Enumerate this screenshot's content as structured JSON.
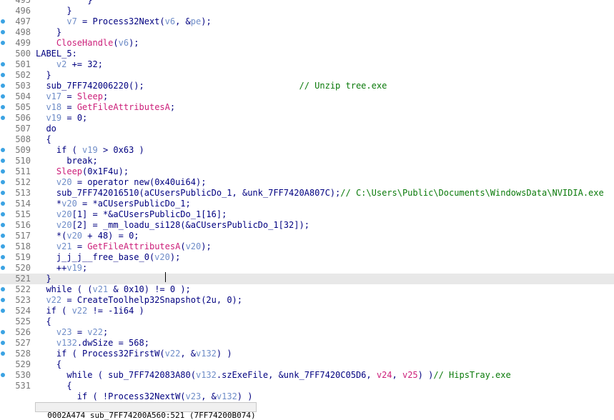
{
  "colors": {
    "background": "#ffffff",
    "line_number": "#777777",
    "keyword": "#000080",
    "variable": "#6f8dc8",
    "api_call": "#cc1f7a",
    "comment": "#0a7a0a",
    "breakpoint_dot": "#3ba3e3",
    "current_line_highlight": "#e8e8e8"
  },
  "status_bar": {
    "text": "0002A474 sub_7FF74200A560:521 (7FF74200B074)"
  },
  "code_lines": [
    {
      "ln": "495",
      "bp": false,
      "segs": [
        {
          "t": "          }",
          "k": "txt"
        }
      ]
    },
    {
      "ln": "496",
      "bp": false,
      "segs": [
        {
          "t": "      }",
          "k": "txt"
        }
      ]
    },
    {
      "ln": "497",
      "bp": true,
      "segs": [
        {
          "t": "      ",
          "k": "txt"
        },
        {
          "t": "v7",
          "k": "var"
        },
        {
          "t": " = Process32Next(",
          "k": "txt"
        },
        {
          "t": "v6",
          "k": "var"
        },
        {
          "t": ", &",
          "k": "txt"
        },
        {
          "t": "pe",
          "k": "var"
        },
        {
          "t": ");",
          "k": "txt"
        }
      ]
    },
    {
      "ln": "498",
      "bp": true,
      "segs": [
        {
          "t": "    }",
          "k": "txt"
        }
      ]
    },
    {
      "ln": "499",
      "bp": true,
      "segs": [
        {
          "t": "    ",
          "k": "txt"
        },
        {
          "t": "CloseHandle",
          "k": "api"
        },
        {
          "t": "(",
          "k": "txt"
        },
        {
          "t": "v6",
          "k": "var"
        },
        {
          "t": ");",
          "k": "txt"
        }
      ]
    },
    {
      "ln": "500",
      "bp": false,
      "segs": [
        {
          "t": "LABEL_5:",
          "k": "txt"
        }
      ]
    },
    {
      "ln": "501",
      "bp": true,
      "segs": [
        {
          "t": "    ",
          "k": "txt"
        },
        {
          "t": "v2",
          "k": "var"
        },
        {
          "t": " += 32;",
          "k": "txt"
        }
      ]
    },
    {
      "ln": "502",
      "bp": true,
      "segs": [
        {
          "t": "  }",
          "k": "txt"
        }
      ]
    },
    {
      "ln": "503",
      "bp": true,
      "segs": [
        {
          "t": "  sub_7FF742006220();                              ",
          "k": "txt"
        },
        {
          "t": "// Unzip tree.exe",
          "k": "cmt"
        }
      ]
    },
    {
      "ln": "504",
      "bp": true,
      "segs": [
        {
          "t": "  ",
          "k": "txt"
        },
        {
          "t": "v17",
          "k": "var"
        },
        {
          "t": " = ",
          "k": "txt"
        },
        {
          "t": "Sleep",
          "k": "api"
        },
        {
          "t": ";",
          "k": "txt"
        }
      ]
    },
    {
      "ln": "505",
      "bp": true,
      "segs": [
        {
          "t": "  ",
          "k": "txt"
        },
        {
          "t": "v18",
          "k": "var"
        },
        {
          "t": " = ",
          "k": "txt"
        },
        {
          "t": "GetFileAttributesA",
          "k": "api"
        },
        {
          "t": ";",
          "k": "txt"
        }
      ]
    },
    {
      "ln": "506",
      "bp": true,
      "segs": [
        {
          "t": "  ",
          "k": "txt"
        },
        {
          "t": "v19",
          "k": "var"
        },
        {
          "t": " = 0;",
          "k": "txt"
        }
      ]
    },
    {
      "ln": "507",
      "bp": false,
      "segs": [
        {
          "t": "  do",
          "k": "kw"
        }
      ]
    },
    {
      "ln": "508",
      "bp": false,
      "segs": [
        {
          "t": "  {",
          "k": "txt"
        }
      ]
    },
    {
      "ln": "509",
      "bp": true,
      "segs": [
        {
          "t": "    if ( ",
          "k": "kw"
        },
        {
          "t": "v19",
          "k": "var"
        },
        {
          "t": " > 0x63 )",
          "k": "txt"
        }
      ]
    },
    {
      "ln": "510",
      "bp": true,
      "segs": [
        {
          "t": "      break;",
          "k": "kw"
        }
      ]
    },
    {
      "ln": "511",
      "bp": true,
      "segs": [
        {
          "t": "    ",
          "k": "txt"
        },
        {
          "t": "Sleep",
          "k": "api"
        },
        {
          "t": "(0x1F4u);",
          "k": "txt"
        }
      ]
    },
    {
      "ln": "512",
      "bp": true,
      "segs": [
        {
          "t": "    ",
          "k": "txt"
        },
        {
          "t": "v20",
          "k": "var"
        },
        {
          "t": " = operator new(0x40ui64);",
          "k": "txt"
        }
      ]
    },
    {
      "ln": "513",
      "bp": true,
      "segs": [
        {
          "t": "    sub_7FF742016510(aCUsersPublicDo_1, &unk_7FF7420A807C);",
          "k": "txt"
        },
        {
          "t": "// C:\\Users\\Public\\Documents\\WindowsData\\NVIDIA.exe",
          "k": "cmt"
        }
      ]
    },
    {
      "ln": "514",
      "bp": true,
      "segs": [
        {
          "t": "    *",
          "k": "txt"
        },
        {
          "t": "v20",
          "k": "var"
        },
        {
          "t": " = *aCUsersPublicDo_1;",
          "k": "txt"
        }
      ]
    },
    {
      "ln": "515",
      "bp": true,
      "segs": [
        {
          "t": "    ",
          "k": "txt"
        },
        {
          "t": "v20",
          "k": "var"
        },
        {
          "t": "[1] = *&aCUsersPublicDo_1[16];",
          "k": "txt"
        }
      ]
    },
    {
      "ln": "516",
      "bp": true,
      "segs": [
        {
          "t": "    ",
          "k": "txt"
        },
        {
          "t": "v20",
          "k": "var"
        },
        {
          "t": "[2] = _mm_loadu_si128(&aCUsersPublicDo_1[32]);",
          "k": "txt"
        }
      ]
    },
    {
      "ln": "517",
      "bp": true,
      "segs": [
        {
          "t": "    *(",
          "k": "txt"
        },
        {
          "t": "v20",
          "k": "var"
        },
        {
          "t": " + 48) = 0;",
          "k": "txt"
        }
      ]
    },
    {
      "ln": "518",
      "bp": true,
      "segs": [
        {
          "t": "    ",
          "k": "txt"
        },
        {
          "t": "v21",
          "k": "var"
        },
        {
          "t": " = ",
          "k": "txt"
        },
        {
          "t": "GetFileAttributesA",
          "k": "api"
        },
        {
          "t": "(",
          "k": "txt"
        },
        {
          "t": "v20",
          "k": "var"
        },
        {
          "t": ");",
          "k": "txt"
        }
      ]
    },
    {
      "ln": "519",
      "bp": true,
      "segs": [
        {
          "t": "    j_j_j__free_base_0(",
          "k": "txt"
        },
        {
          "t": "v20",
          "k": "var"
        },
        {
          "t": ");",
          "k": "txt"
        }
      ]
    },
    {
      "ln": "520",
      "bp": true,
      "segs": [
        {
          "t": "    ++",
          "k": "txt"
        },
        {
          "t": "v19",
          "k": "var"
        },
        {
          "t": ";",
          "k": "txt"
        }
      ]
    },
    {
      "ln": "521",
      "bp": false,
      "current": true,
      "segs": [
        {
          "t": "  }",
          "k": "txt"
        }
      ]
    },
    {
      "ln": "522",
      "bp": true,
      "segs": [
        {
          "t": "  while ( (",
          "k": "kw"
        },
        {
          "t": "v21",
          "k": "var"
        },
        {
          "t": " & 0x10) != 0 );",
          "k": "txt"
        }
      ]
    },
    {
      "ln": "523",
      "bp": true,
      "segs": [
        {
          "t": "  ",
          "k": "txt"
        },
        {
          "t": "v22",
          "k": "var"
        },
        {
          "t": " = CreateToolhelp32Snapshot(2u, 0);",
          "k": "txt"
        }
      ]
    },
    {
      "ln": "524",
      "bp": true,
      "segs": [
        {
          "t": "  if ( ",
          "k": "kw"
        },
        {
          "t": "v22",
          "k": "var"
        },
        {
          "t": " != -1i64 )",
          "k": "txt"
        }
      ]
    },
    {
      "ln": "525",
      "bp": false,
      "segs": [
        {
          "t": "  {",
          "k": "txt"
        }
      ]
    },
    {
      "ln": "526",
      "bp": true,
      "segs": [
        {
          "t": "    ",
          "k": "txt"
        },
        {
          "t": "v23",
          "k": "var"
        },
        {
          "t": " = ",
          "k": "txt"
        },
        {
          "t": "v22",
          "k": "var"
        },
        {
          "t": ";",
          "k": "txt"
        }
      ]
    },
    {
      "ln": "527",
      "bp": true,
      "segs": [
        {
          "t": "    ",
          "k": "txt"
        },
        {
          "t": "v132",
          "k": "var"
        },
        {
          "t": ".dwSize = 568;",
          "k": "txt"
        }
      ]
    },
    {
      "ln": "528",
      "bp": true,
      "segs": [
        {
          "t": "    if ( Process32FirstW(",
          "k": "txt"
        },
        {
          "t": "v22",
          "k": "var"
        },
        {
          "t": ", &",
          "k": "txt"
        },
        {
          "t": "v132",
          "k": "var"
        },
        {
          "t": ") )",
          "k": "txt"
        }
      ]
    },
    {
      "ln": "529",
      "bp": false,
      "segs": [
        {
          "t": "    {",
          "k": "txt"
        }
      ]
    },
    {
      "ln": "530",
      "bp": true,
      "segs": [
        {
          "t": "      while ( sub_7FF742083A80(",
          "k": "txt"
        },
        {
          "t": "v132",
          "k": "var"
        },
        {
          "t": ".szExeFile, &unk_7FF7420C05D6, ",
          "k": "txt"
        },
        {
          "t": "v24",
          "k": "api"
        },
        {
          "t": ", ",
          "k": "txt"
        },
        {
          "t": "v25",
          "k": "api"
        },
        {
          "t": ") )",
          "k": "txt"
        },
        {
          "t": "// HipsTray.exe",
          "k": "cmt"
        }
      ]
    },
    {
      "ln": "531",
      "bp": false,
      "segs": [
        {
          "t": "      {",
          "k": "txt"
        }
      ]
    },
    {
      "ln": "",
      "bp": false,
      "segs": [
        {
          "t": "        if ( !Process32NextW(",
          "k": "txt"
        },
        {
          "t": "v23",
          "k": "var"
        },
        {
          "t": ", &",
          "k": "txt"
        },
        {
          "t": "v132",
          "k": "var"
        },
        {
          "t": ") )",
          "k": "txt"
        }
      ]
    }
  ]
}
